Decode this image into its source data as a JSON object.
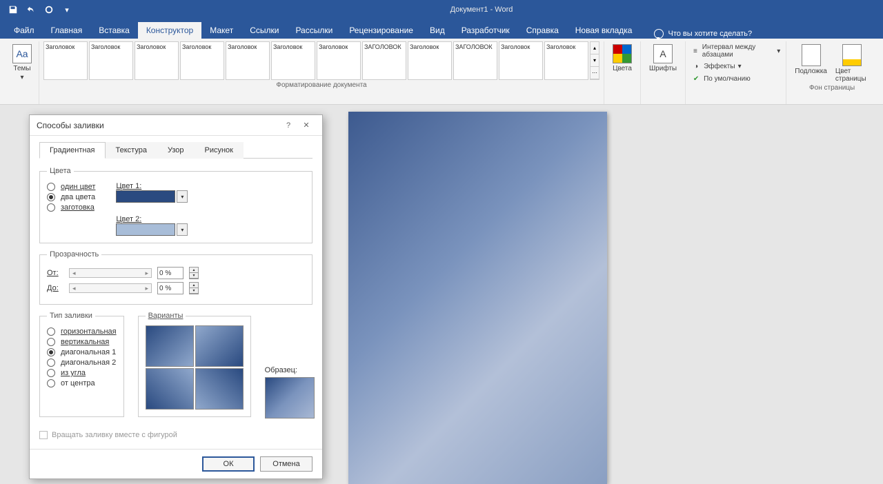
{
  "titlebar": {
    "title": "Документ1 - Word"
  },
  "tabs": {
    "file": "Файл",
    "home": "Главная",
    "insert": "Вставка",
    "design": "Конструктор",
    "layout": "Макет",
    "references": "Ссылки",
    "mailings": "Рассылки",
    "review": "Рецензирование",
    "view": "Вид",
    "developer": "Разработчик",
    "help": "Справка",
    "new_tab": "Новая вкладка",
    "tell_me": "Что вы хотите сделать?"
  },
  "ribbon": {
    "themes": "Темы",
    "gallery_heading": "Заголовок",
    "gallery_heading_caps": "ЗАГОЛОВОК",
    "group_formatting": "Форматирование документа",
    "colors": "Цвета",
    "fonts": "Шрифты",
    "spacing": "Интервал между абзацами",
    "effects": "Эффекты",
    "default": "По умолчанию",
    "watermark": "Подложка",
    "page_color": "Цвет страницы",
    "page_bg": "Фон страницы"
  },
  "dialog": {
    "title": "Способы заливки",
    "help": "?",
    "tabs": {
      "gradient": "Градиентная",
      "texture": "Текстура",
      "pattern": "Узор",
      "picture": "Рисунок"
    },
    "colors_legend": "Цвета",
    "one_color": "один цвет",
    "two_colors": "два цвета",
    "preset": "заготовка",
    "color1": "Цвет 1:",
    "color2": "Цвет 2:",
    "swatch1": "#2a4a80",
    "swatch2": "#a8bdd8",
    "transparency_legend": "Прозрачность",
    "from": "От:",
    "to": "До:",
    "pct": "0 %",
    "fill_type_legend": "Тип заливки",
    "horizontal": "горизонтальная",
    "vertical": "вертикальная",
    "diag1": "диагональная 1",
    "diag2": "диагональная 2",
    "corner": "из угла",
    "center": "от центра",
    "variants_legend": "Варианты",
    "sample": "Образец:",
    "rotate": "Вращать заливку вместе с фигурой",
    "ok": "ОК",
    "cancel": "Отмена"
  }
}
